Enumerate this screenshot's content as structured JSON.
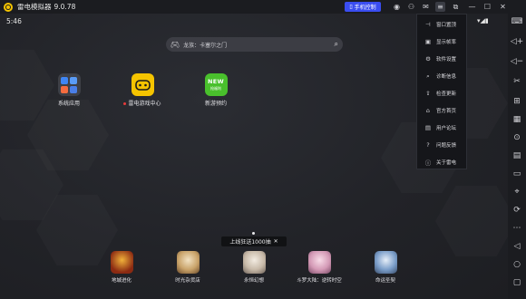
{
  "titlebar": {
    "app_title": "雷电模拟器",
    "version": "9.0.78",
    "phone_control_label": "手机控制",
    "icons": [
      "controller-icon",
      "user-icon",
      "mail-icon",
      "menu-icon",
      "restore-icon",
      "minimize-icon",
      "maximize-icon",
      "close-icon"
    ]
  },
  "status_bar": {
    "time": "5:46",
    "icons": "▾◢▮"
  },
  "search": {
    "placeholder": "龙族：卡塞尔之门"
  },
  "desktop_apps": [
    {
      "label": "系统应用",
      "icon": "system-apps-icon"
    },
    {
      "label": "雷电游戏中心",
      "icon": "game-center-icon",
      "badge": "new-dot"
    },
    {
      "label": "新游预约",
      "icon": "new-game-icon",
      "badge_text": "NEW",
      "sub_text": "抢福利"
    }
  ],
  "promo_banner": {
    "text": "上线狂送1000抽",
    "close": "✕"
  },
  "dock_apps": [
    {
      "label": "地城进化",
      "color": "#8b2a12"
    },
    {
      "label": "时光杂货店",
      "color": "#c9a36a"
    },
    {
      "label": "永恒幻想",
      "color": "#c7b9a8"
    },
    {
      "label": "斗罗大陆：逆转时空",
      "color": "#d49ab6"
    },
    {
      "label": "命运圣契",
      "color": "#7b9ec9"
    }
  ],
  "menu": {
    "items": [
      {
        "label": "窗口置顶",
        "icon": "pin-icon",
        "glyph": "⊣"
      },
      {
        "label": "显示帧率",
        "icon": "fps-icon",
        "glyph": "▣"
      },
      {
        "label": "软件设置",
        "icon": "settings-icon",
        "glyph": "⚙"
      },
      {
        "label": "诊断信息",
        "icon": "diagnose-icon",
        "glyph": "⌕"
      },
      {
        "label": "检查更新",
        "icon": "update-icon",
        "glyph": "⇪"
      },
      {
        "label": "官方首页",
        "icon": "home-icon",
        "glyph": "⌂"
      },
      {
        "label": "用户论坛",
        "icon": "forum-icon",
        "glyph": "▤"
      },
      {
        "label": "问题反馈",
        "icon": "feedback-icon",
        "glyph": "?"
      },
      {
        "label": "关于雷电",
        "icon": "about-icon",
        "glyph": "ⓘ"
      }
    ]
  },
  "sidebar": {
    "icons": [
      "keyboard-icon",
      "volume-up-icon",
      "volume-down-icon",
      "screenshot-icon",
      "add-app-icon",
      "keymap-icon",
      "record-icon",
      "operation-icon",
      "folder-icon",
      "location-icon",
      "sync-icon",
      "more-icon",
      "back-icon",
      "home-nav-icon",
      "recent-apps-icon"
    ]
  },
  "colors": {
    "accent": "#3a4df0",
    "brand_yellow": "#f5c400",
    "new_green": "#49c02c",
    "background": "#1f2024"
  }
}
